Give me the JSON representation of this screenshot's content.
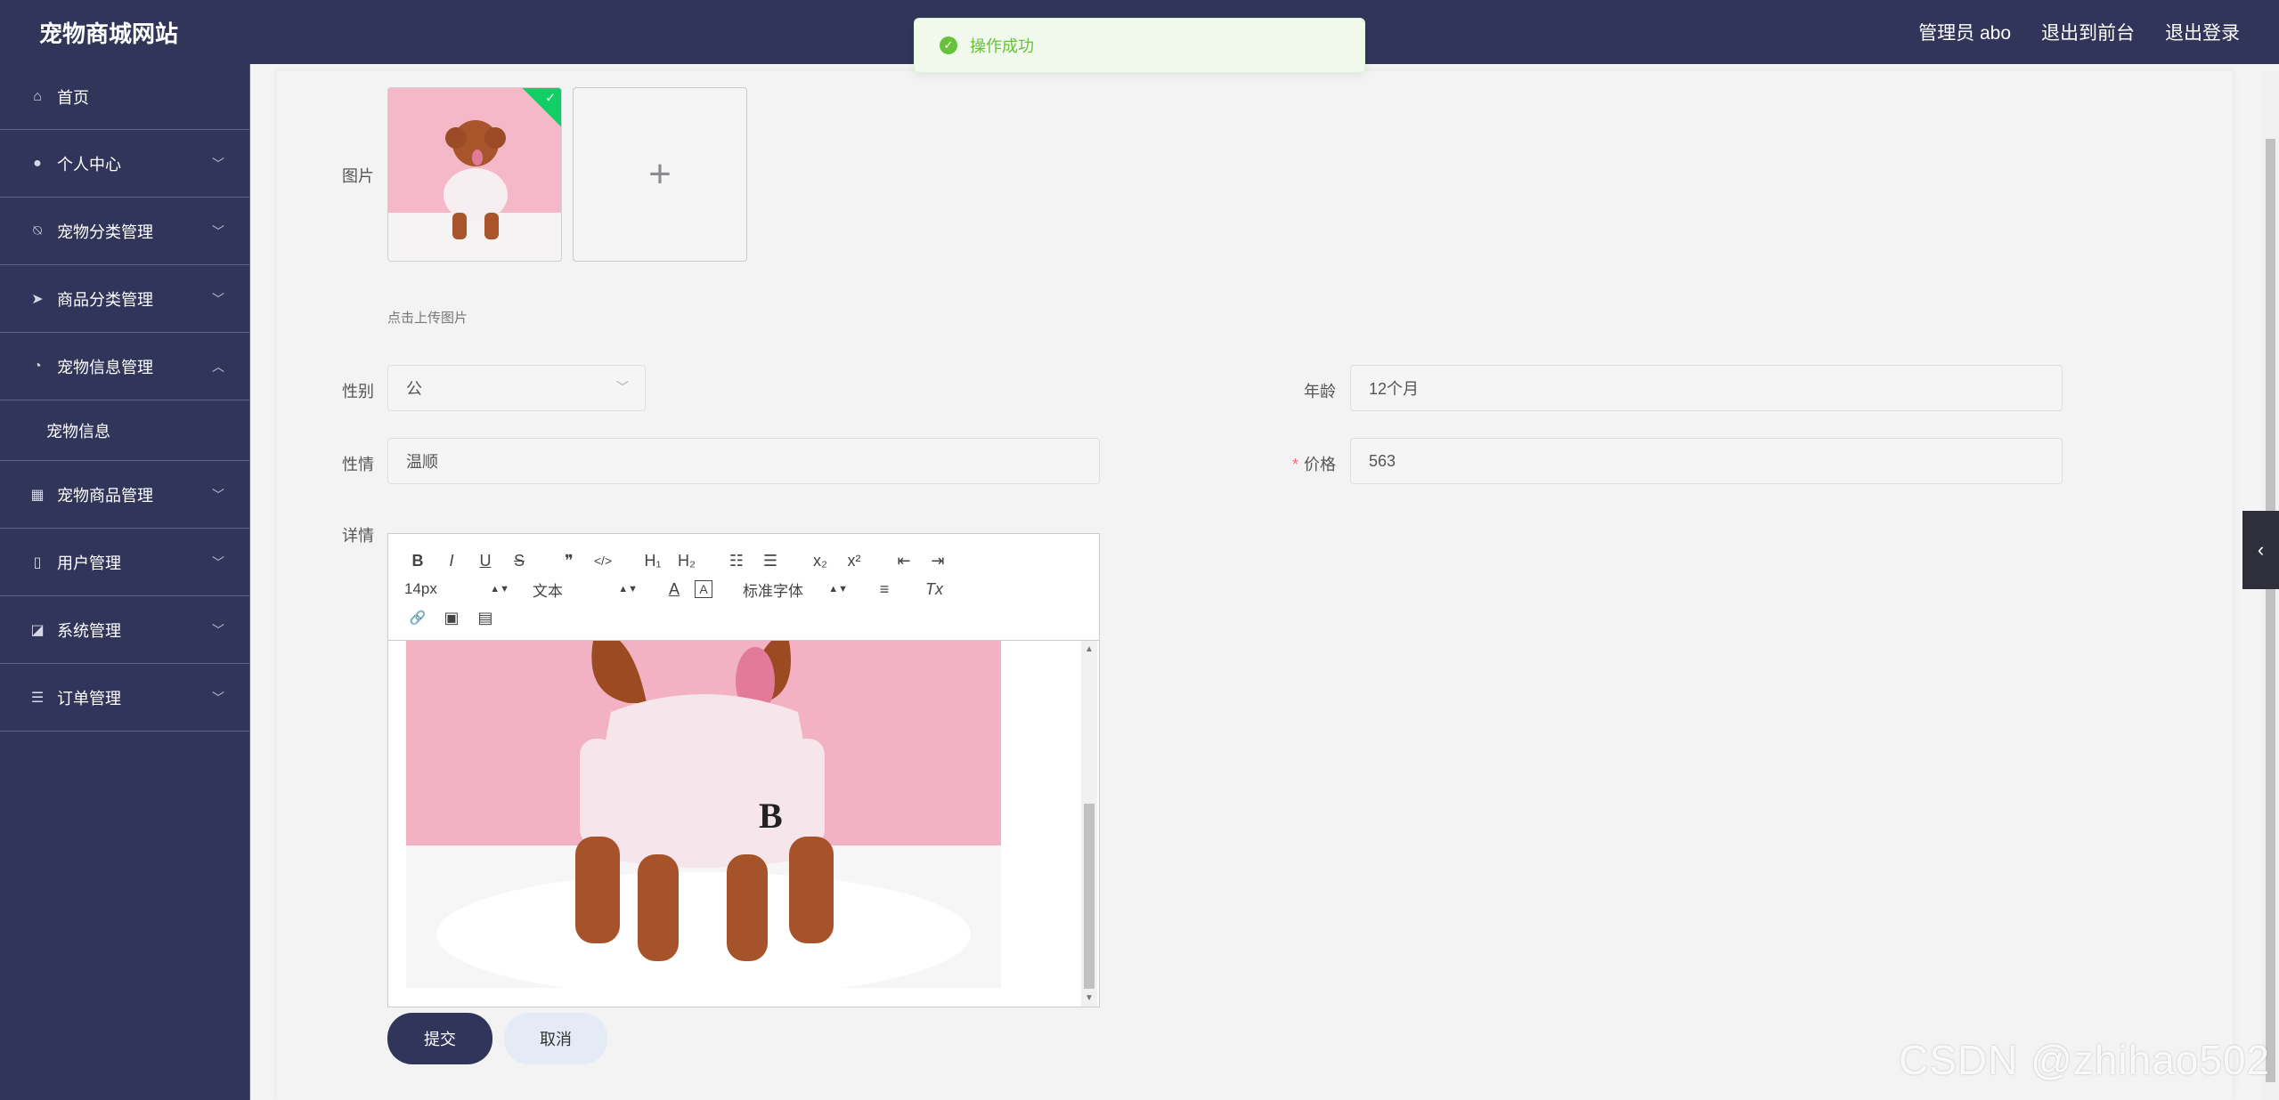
{
  "app": {
    "title": "宠物商城网站",
    "user_label": "管理员 abo",
    "to_front": "退出到前台",
    "logout": "退出登录"
  },
  "toast": {
    "message": "操作成功"
  },
  "sidebar": {
    "items": [
      {
        "label": "首页",
        "icon": "home-icon"
      },
      {
        "label": "个人中心",
        "icon": "user-icon"
      },
      {
        "label": "宠物分类管理",
        "icon": "bell-off-icon"
      },
      {
        "label": "商品分类管理",
        "icon": "paper-plane-icon"
      },
      {
        "label": "宠物信息管理",
        "icon": "compass-icon",
        "expanded": true
      },
      {
        "label": "宠物商品管理",
        "icon": "grid-icon"
      },
      {
        "label": "用户管理",
        "icon": "mobile-icon"
      },
      {
        "label": "系统管理",
        "icon": "chart-icon"
      },
      {
        "label": "订单管理",
        "icon": "menu-icon"
      }
    ],
    "submenu_item": "宠物信息"
  },
  "form": {
    "image_label": "图片",
    "upload_hint": "点击上传图片",
    "gender_label": "性别",
    "gender_value": "公",
    "age_label": "年龄",
    "age_value": "12个月",
    "temper_label": "性情",
    "temper_value": "温顺",
    "price_required": "*",
    "price_label": "价格",
    "price_value": "563",
    "detail_label": "详情"
  },
  "editor": {
    "font_size": "14px",
    "text_style": "文本",
    "font_family": "标准字体",
    "buttons": {
      "bold": "B",
      "italic": "I",
      "underline": "U",
      "strike": "S",
      "quote": "❞",
      "code": "</>",
      "h1": "H₁",
      "h2": "H₂",
      "ol": "☷",
      "ul": "☰",
      "sub": "x₂",
      "sup": "x²",
      "outdent": "⇤",
      "indent": "⇥",
      "color": "A",
      "bg": "A",
      "align": "≡",
      "clean": "Tx",
      "link": "🔗",
      "image": "▣",
      "video": "▤"
    }
  },
  "buttons": {
    "submit": "提交",
    "cancel": "取消"
  },
  "watermark": "CSDN @zhihao502",
  "colors": {
    "primary": "#31355a",
    "success": "#67c23a",
    "required": "#f56c6c"
  }
}
